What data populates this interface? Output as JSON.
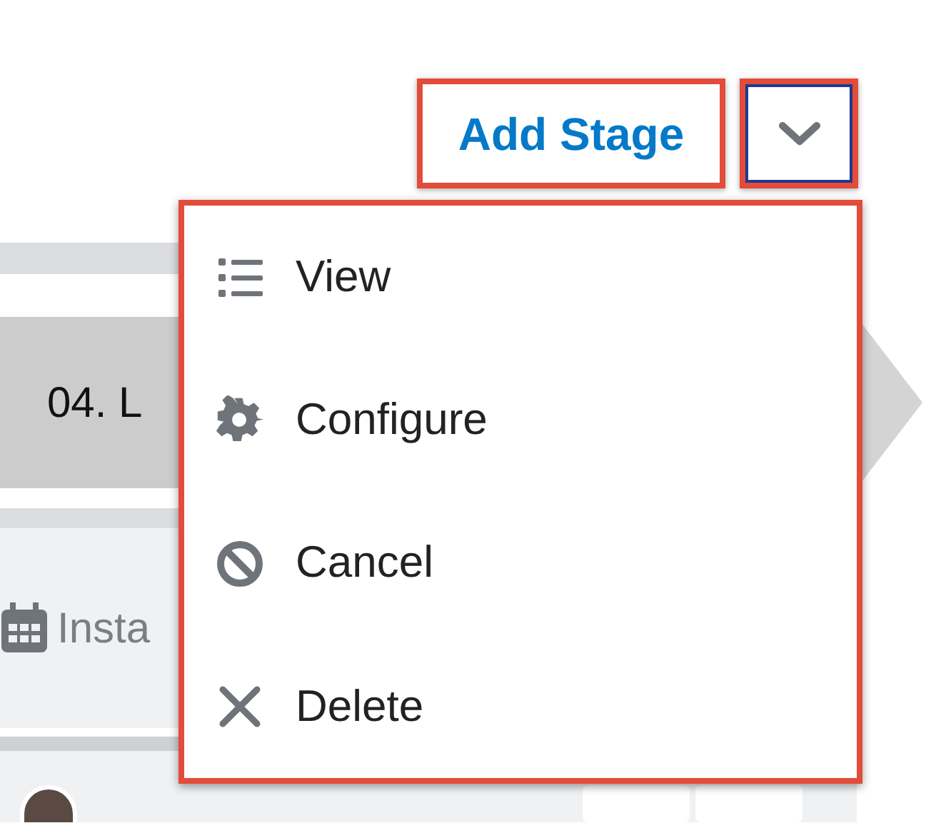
{
  "stage": {
    "label": "04. L"
  },
  "record": {
    "text": "Insta"
  },
  "toolbar": {
    "add_button": "Add Stage"
  },
  "menu": {
    "items": [
      {
        "kind": "list",
        "label": "View"
      },
      {
        "kind": "gear",
        "label": "Configure"
      },
      {
        "kind": "ban",
        "label": "Cancel"
      },
      {
        "kind": "close",
        "label": "Delete"
      }
    ]
  }
}
